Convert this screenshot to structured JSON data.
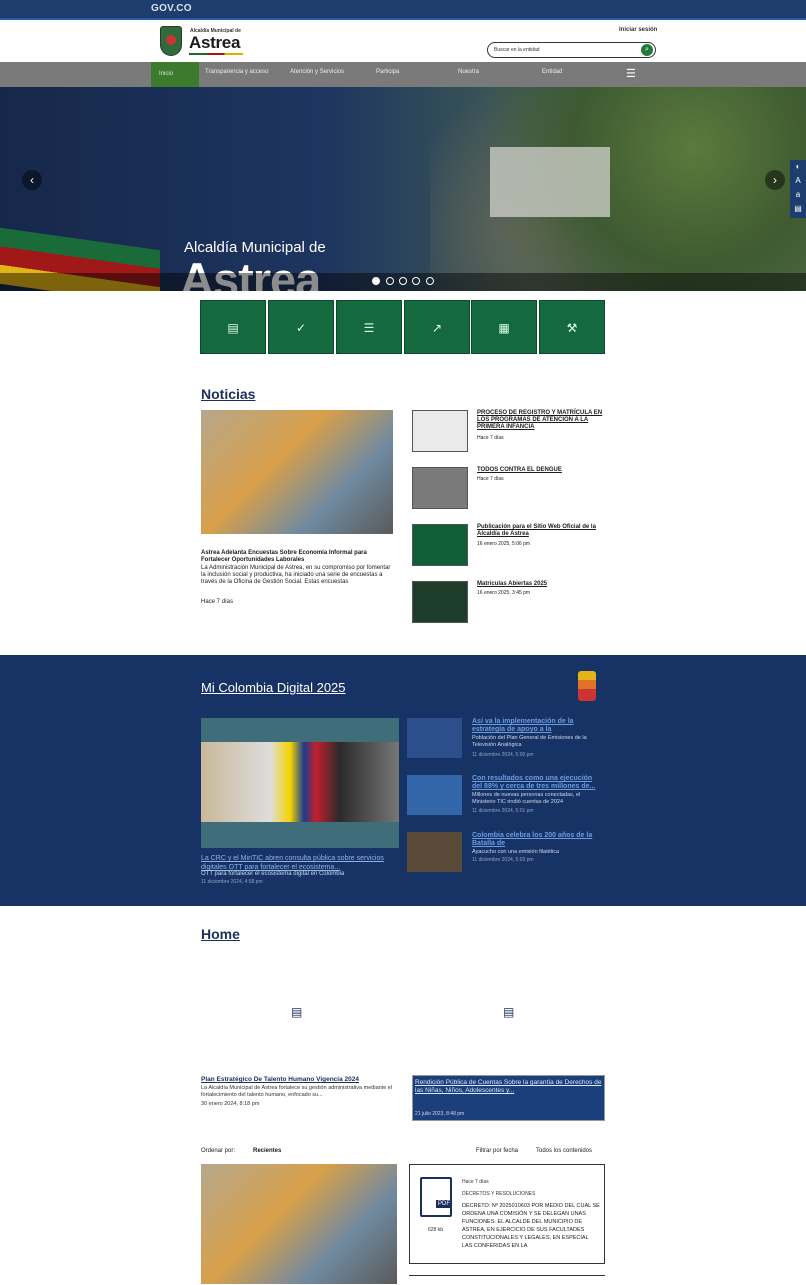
{
  "govbar": {
    "logo": "GOV.CO"
  },
  "header": {
    "brand_small": "Alcaldía Municipal de",
    "brand_big": "Astrea",
    "login": "Iniciar sesión",
    "search_placeholder": "Buscar en la entidad"
  },
  "nav": {
    "home": "Inicio",
    "items": [
      "Transparencia y acceso",
      "Atención y Servicios",
      "Participa",
      "Nuestra",
      "Entidad"
    ]
  },
  "hero": {
    "subtitle": "Alcaldía Municipal de",
    "title": "Astrea",
    "slide_count": 5,
    "active_slide": 1
  },
  "quick_links": [
    "document-icon",
    "check-icon",
    "form-icon",
    "chart-icon",
    "calendar-icon",
    "hammer-icon"
  ],
  "news": {
    "title": "Noticias",
    "main": {
      "title": "Astrea Adelanta Encuestas Sobre Economía Informal para Fortalecer Oportunidades Laborales",
      "body": "La Administración Municipal de Astrea, en su compromiso por fomentar la inclusión social y productiva, ha iniciado una serie de encuestas a través de la Oficina de Gestión Social. Estas encuestas",
      "time": "Hace 7 días"
    },
    "items": [
      {
        "title": "PROCESO DE REGISTRO Y MATRÍCULA EN LOS PROGRAMAS DE ATENCIÓN A LA PRIMERA INFANCIA",
        "time": "Hace 7 días"
      },
      {
        "title": "TODOS CONTRA EL DENGUE",
        "time": "Hace 7 días"
      },
      {
        "title": "Publicación para el Sitio Web Oficial de la Alcaldía de Astrea",
        "time": "16 enero 2025, 5:06 pm"
      },
      {
        "title": "Matrículas Abiertas 2025",
        "time": "16 enero 2025, 3:45 pm"
      }
    ]
  },
  "mcd": {
    "title": "Mi Colombia Digital 2025",
    "main": {
      "title": "La CRC y el MinTIC abren consulta pública sobre servicios digitales OTT para fortalecer el ecosistema...",
      "sub": "OTT para fortalecer el ecosistema digital en Colombia",
      "time": "11 diciembre 2024, 4:58 pm"
    },
    "items": [
      {
        "title": "Así va la implementación de la estrategia de apoyo a la",
        "sub": "Población del Plan General de Emisiones de la Televisión Analógica",
        "time": "11 diciembre 2024, 5:00 pm"
      },
      {
        "title": "Con resultados como una ejecución del 88% y cerca de tres millones de...",
        "sub": "Millones de nuevas personas conectadas, el Ministerio TIC rindió cuentas de 2024",
        "time": "11 diciembre 2024, 5:01 pm"
      },
      {
        "title": "Colombia celebra los 200 años de la Batalla de",
        "sub": "Ayacucho con una emisión filatélica",
        "time": "11 diciembre 2024, 5:03 pm"
      }
    ]
  },
  "home": {
    "title": "Home",
    "docs": [
      {
        "title": "Plan Estratégico De Talento Humano Vigencia 2024",
        "body": "La Alcaldía Municipal de Astrea fortalece su gestión administrativa mediante el fortalecimiento del talento humano, enfocado su...",
        "time": "30 enero 2024, 8:18 pm"
      },
      {
        "title": "Rendición Pública de Cuentas Sobre la garantía de Derechos de las Niñas, Niños, Adolescentes y...",
        "time": "21 julio 2023, 8:48 pm"
      }
    ],
    "sort_label": "Ordenar por:",
    "sort_value": "Recientes",
    "filter_date": "Filtrar por fecha",
    "filter_all": "Todos los contenidos",
    "pdf": {
      "label": "PDF",
      "size": "628 kb",
      "meta": "Hace 7 días",
      "category": "DECRETOS Y RESOLUCIONES",
      "text": "DECRETO: Nº 2025010603 POR MEDIO DEL CUAL SE ORDENA UNA COMISIÓN Y SE DELEGAN UNAS FUNCIONES. EL ALCALDE DEL MUNICIPIO DE ASTREA, EN EJERCICIO DE SUS FACULTADES CONSTITUCIONALES Y LEGALES, EN ESPECIAL LAS CONFERIDAS EN LA"
    }
  }
}
